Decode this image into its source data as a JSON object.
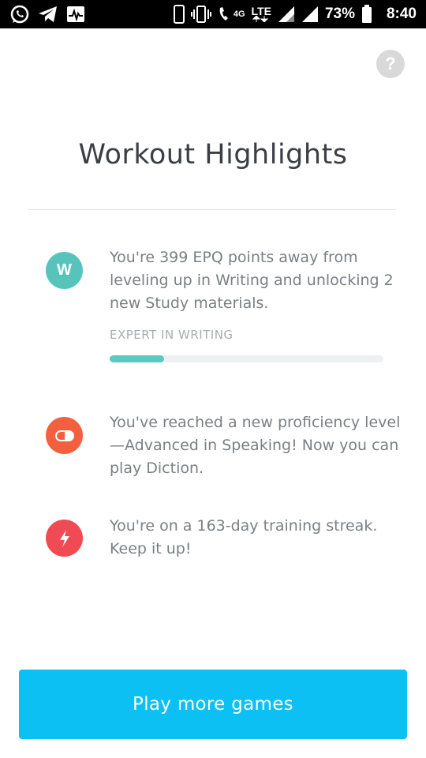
{
  "status_bar": {
    "network_small": "4G",
    "lte": "LTE",
    "battery": "73%",
    "time": "8:40",
    "icons": [
      "whatsapp-icon",
      "telegram-icon",
      "activity-icon",
      "phone-icon",
      "vibrate-icon",
      "wifi-calling-icon",
      "signal-icon",
      "signal-icon",
      "battery-icon"
    ]
  },
  "help_label": "?",
  "title": "Workout Highlights",
  "highlights": [
    {
      "badge_letter": "W",
      "badge_color": "#57c4bc",
      "text": "You're 399 EPQ points away from leveling up in Writing and unlocking 2 new Study materials.",
      "caption": "EXPERT IN WRITING",
      "progress": 0.2
    },
    {
      "badge_icon": "speaking-icon",
      "badge_color": "#f2603f",
      "text": "You've reached a new proficiency level—Advanced in Speaking! Now you can play Diction."
    },
    {
      "badge_icon": "lightning-icon",
      "badge_color": "#f04b54",
      "text": "You're on a 163-day training streak. Keep it up!"
    }
  ],
  "cta_label": "Play more games",
  "colors": {
    "cta": "#0cc0f3",
    "progress_fill": "#5dc8c0"
  }
}
